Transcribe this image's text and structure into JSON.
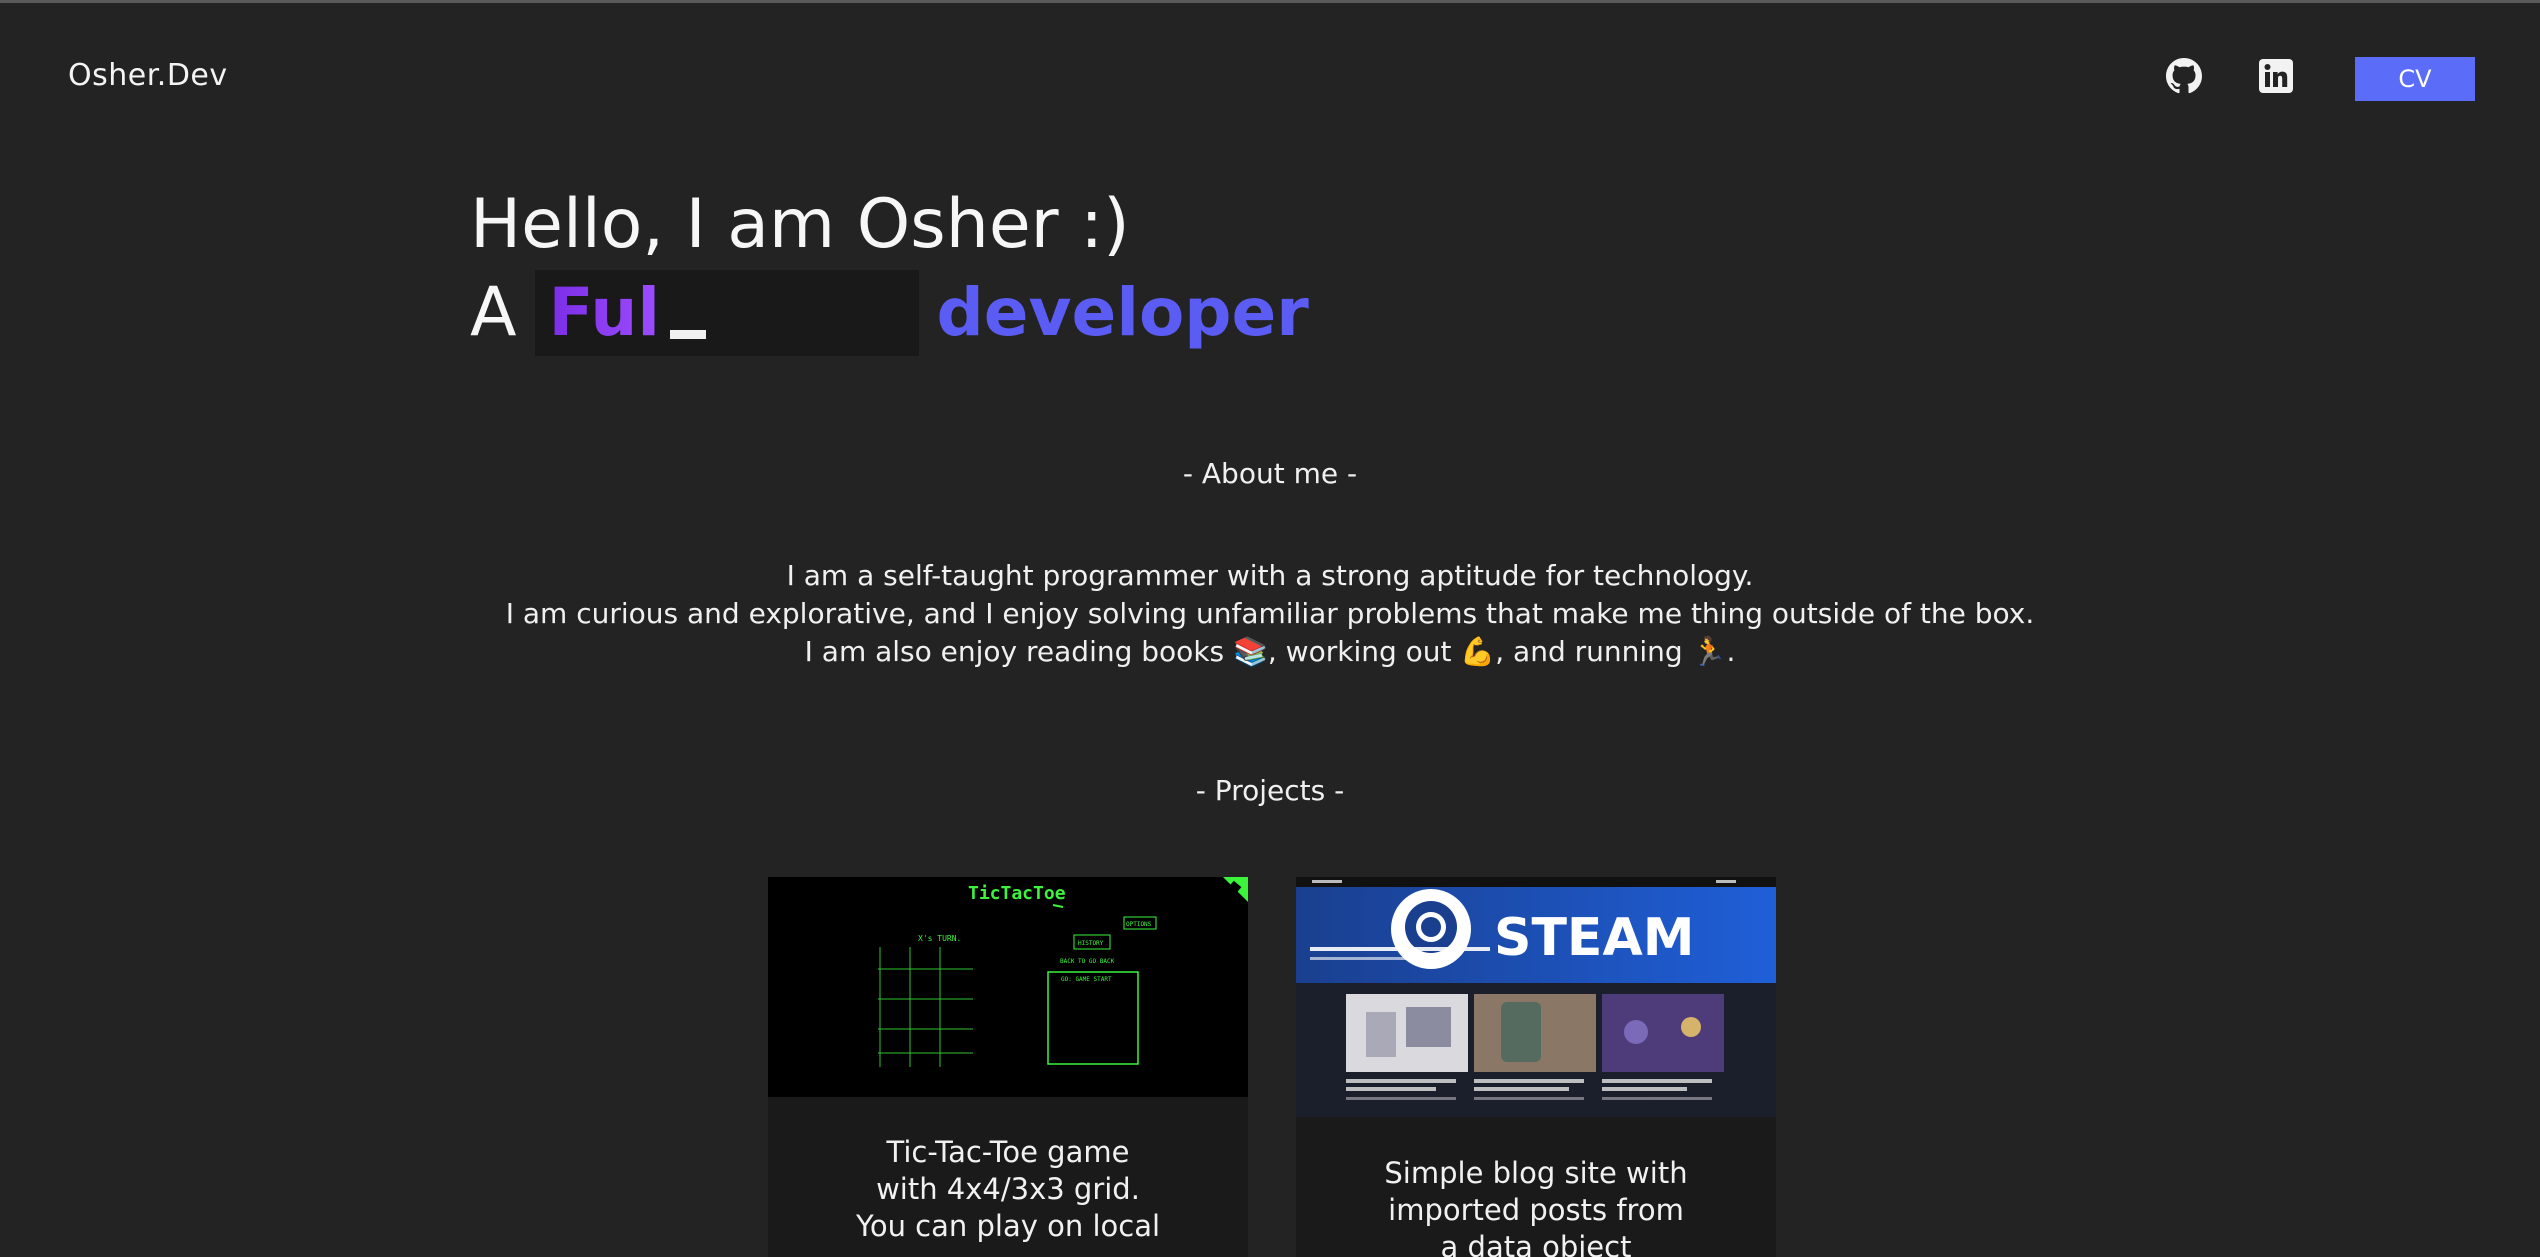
{
  "header": {
    "brand": "Osher.Dev",
    "github_icon": "github-icon",
    "linkedin_icon": "linkedin-icon",
    "cv_label": "CV"
  },
  "hero": {
    "greeting": "Hello, I am Osher :)",
    "prefix": "A",
    "typed_text": "Ful",
    "suffix": "developer"
  },
  "about": {
    "title": "- About me -",
    "lines": [
      "I am a self-taught programmer with a strong aptitude for technology.",
      "I am curious and explorative, and I enjoy solving unfamiliar problems that make me thing outside of the box.",
      "I am also enjoy reading books 📚, working out 💪, and running 🏃."
    ]
  },
  "projects": {
    "title": "- Projects -",
    "items": [
      {
        "description_lines": [
          "Tic-Tac-Toe game",
          "with 4x4/3x3 grid.",
          "You can play on local"
        ],
        "thumb_title": "TicTacToe",
        "thumb_turn": "X's TURN.",
        "thumb_history": "HISTORY",
        "thumb_back": "BACK TO GO BACK",
        "thumb_options": "OPTIONS",
        "thumb_start": "GO: GAME START"
      },
      {
        "description_lines": [
          "Simple blog site with",
          "imported posts from",
          "a data object"
        ],
        "thumb_brand": "STEAM"
      }
    ]
  },
  "colors": {
    "background": "#232323",
    "accent_blue": "#5b6df8",
    "typed_purple": "#8a3cf0",
    "developer_blue": "#5b5cf3",
    "card_bg": "#1a1a1a",
    "terminal_green": "#3cf43c"
  }
}
